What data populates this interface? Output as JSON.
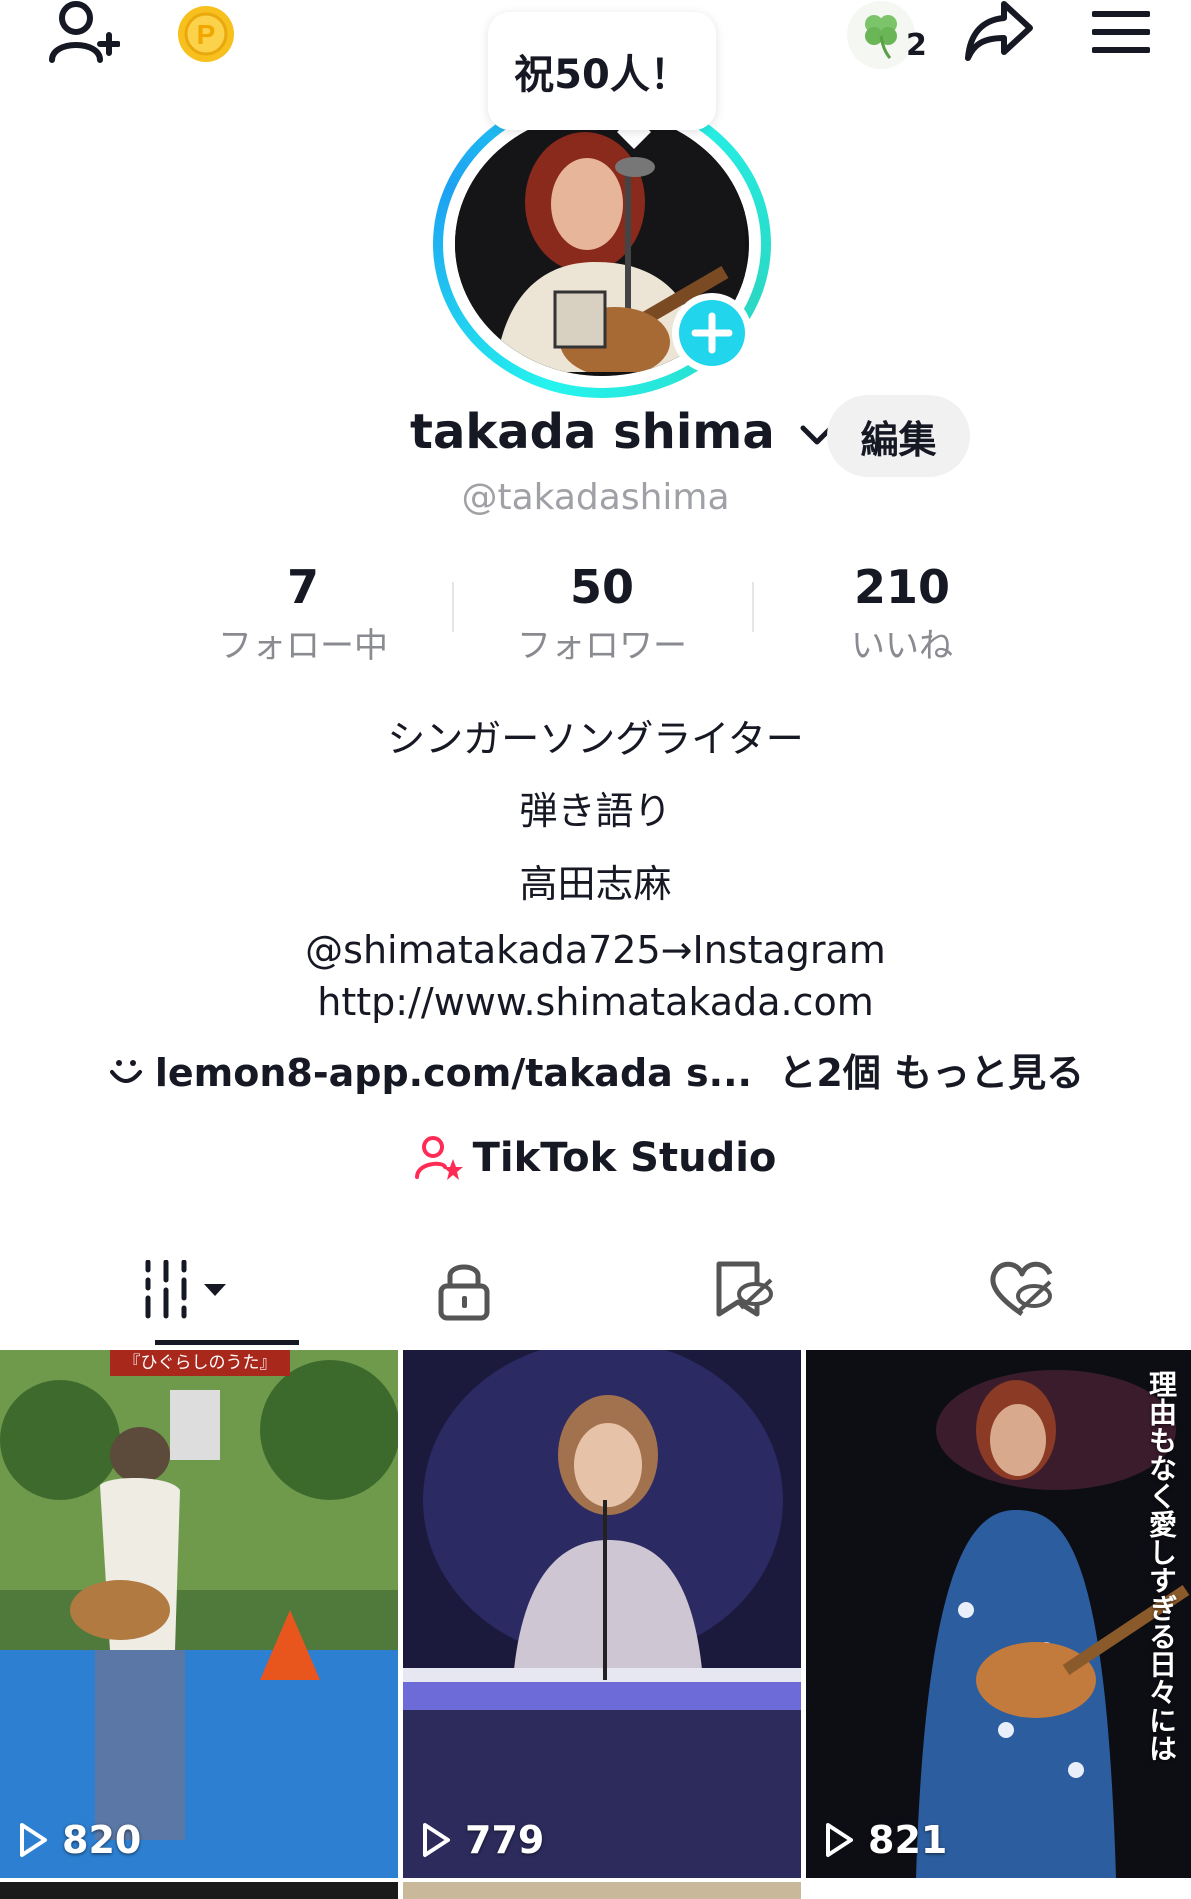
{
  "celebration_bubble": "祝50人！",
  "profile": {
    "display_name": "takada shima",
    "handle": "@takadashima",
    "edit_label": "編集"
  },
  "top_bar": {
    "notification_count": "2"
  },
  "stats": [
    {
      "value": "7",
      "label": "フォロー中"
    },
    {
      "value": "50",
      "label": "フォロワー"
    },
    {
      "value": "210",
      "label": "いいね"
    }
  ],
  "bio": {
    "line1": "シンガーソングライター",
    "line2": "弾き語り",
    "line3": "高田志麻",
    "line4": "@shimatakada725→Instagram",
    "line5": "http://www.shimatakada.com"
  },
  "links": {
    "text": "lemon8-app.com/takada s...",
    "more_count": "と2個",
    "more_label": "もっと見る"
  },
  "studio": {
    "label": "TikTok Studio"
  },
  "videos": [
    {
      "views": "820",
      "caption": "『ひぐらしのうた』"
    },
    {
      "views": "779"
    },
    {
      "views": "821",
      "caption": "理由もなく愛しすぎる日々には"
    }
  ],
  "colors": {
    "accent_cyan": "#20d5ec",
    "studio_icon": "#fe2c55",
    "text_primary": "#161823",
    "text_secondary": "#8a8b91"
  }
}
